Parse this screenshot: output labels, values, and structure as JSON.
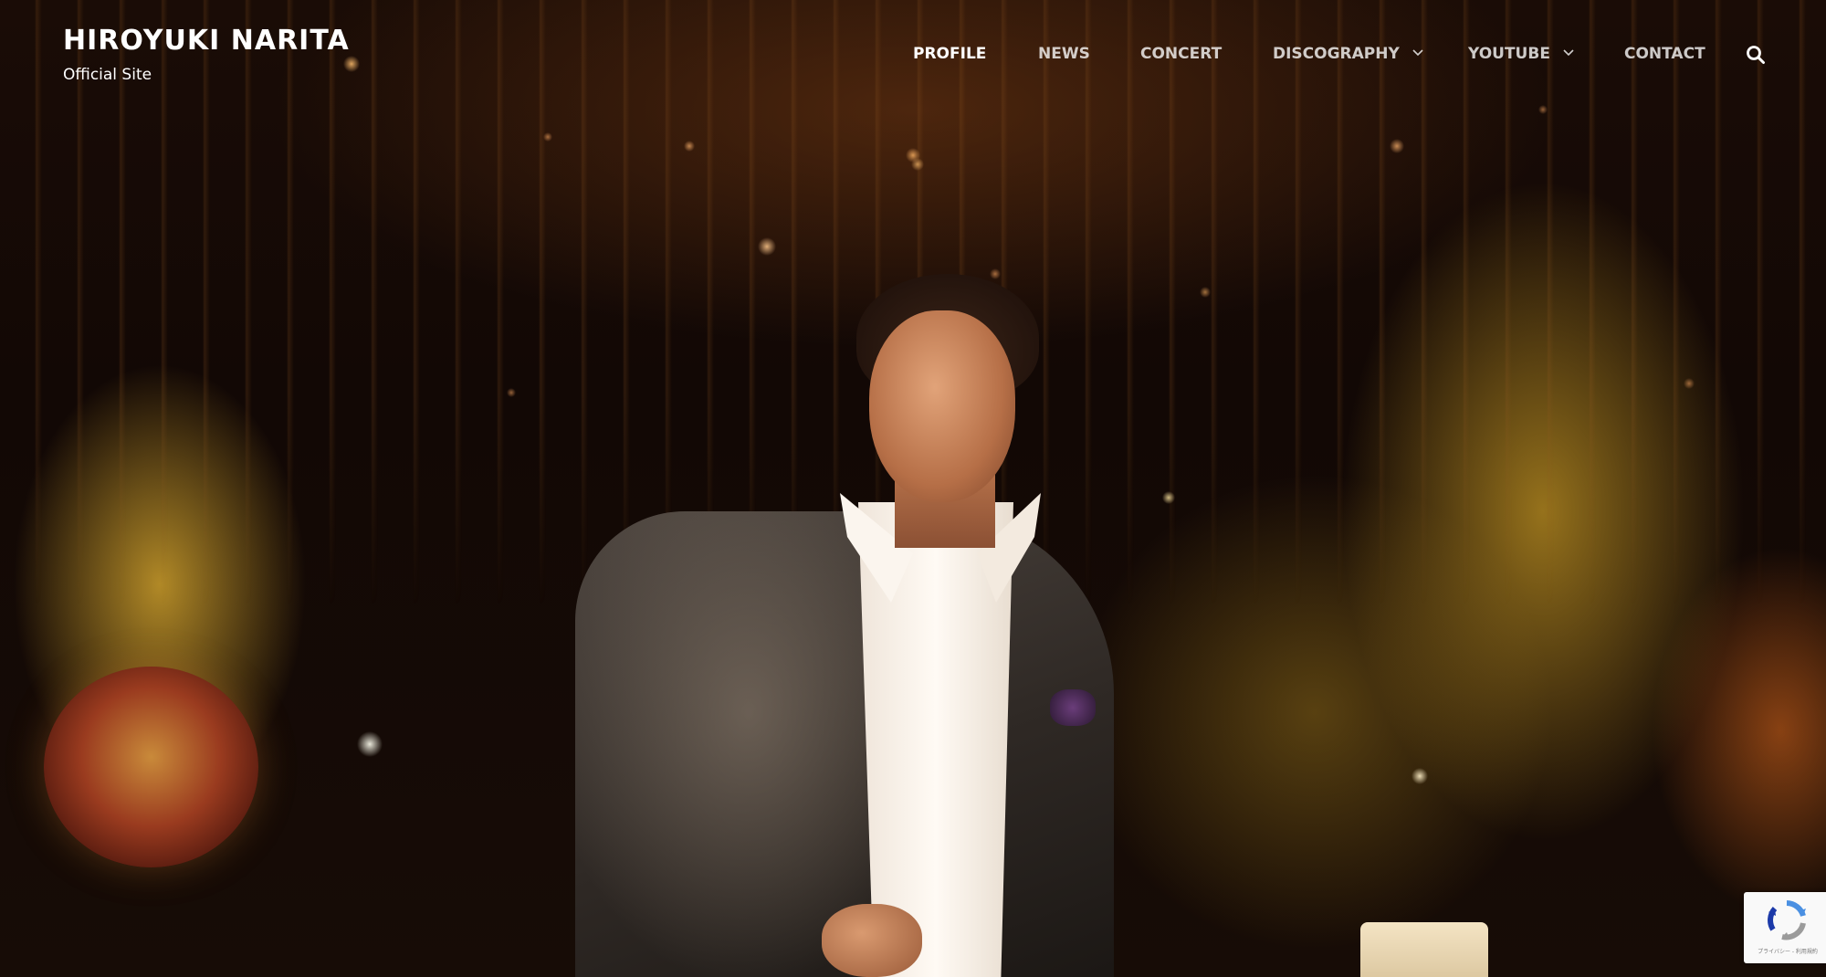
{
  "site": {
    "title": "HIROYUKI NARITA",
    "tagline": "Official Site"
  },
  "nav": {
    "items": [
      {
        "label": "PROFILE",
        "active": true,
        "has_dropdown": false
      },
      {
        "label": "NEWS",
        "active": false,
        "has_dropdown": false
      },
      {
        "label": "CONCERT",
        "active": false,
        "has_dropdown": false
      },
      {
        "label": "DISCOGRAPHY",
        "active": false,
        "has_dropdown": true
      },
      {
        "label": "YOUTUBE",
        "active": false,
        "has_dropdown": true
      },
      {
        "label": "CONTACT",
        "active": false,
        "has_dropdown": false
      }
    ],
    "search_icon": "search-icon",
    "dropdown_icon": "chevron-down-icon"
  },
  "hero": {
    "image": "Man in grey suit and white shirt speaking in a dimly lit temple with golden hanging ornaments"
  },
  "recaptcha": {
    "links": "プライバシー - 利用規約"
  },
  "colors": {
    "nav_text": "#ffffff",
    "background": "#120805"
  }
}
